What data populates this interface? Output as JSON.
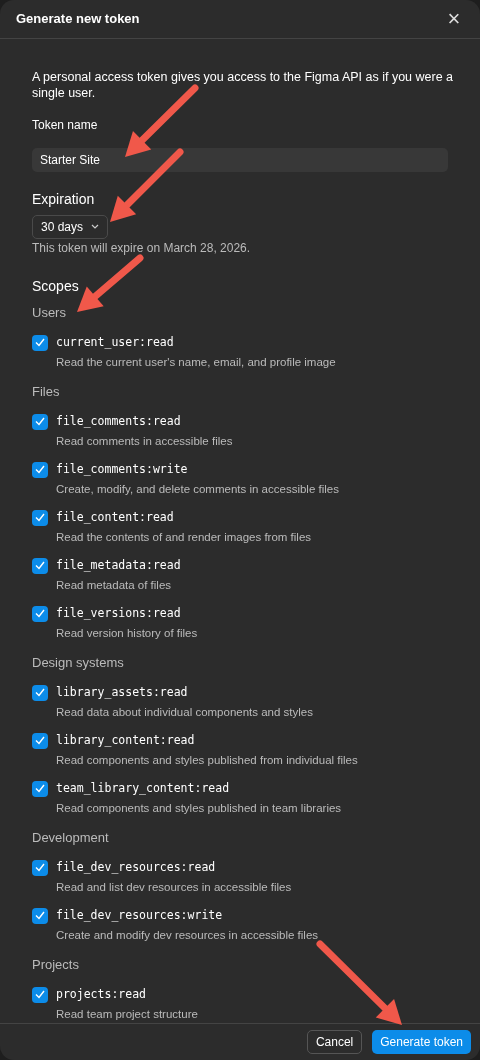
{
  "dialog": {
    "title": "Generate new token",
    "close": "×"
  },
  "description": "A personal access token gives you access to the Figma API as if you were a single user.",
  "token_name": {
    "label": "Token name",
    "value": "Starter Site"
  },
  "expiration": {
    "heading": "Expiration",
    "value": "30 days",
    "note": "This token will expire on March 28, 2026."
  },
  "scopes": {
    "heading": "Scopes",
    "groups": [
      {
        "name": "Users",
        "items": [
          {
            "name": "current_user:read",
            "description": "Read the current user's name, email, and profile image",
            "checked": true
          }
        ]
      },
      {
        "name": "Files",
        "items": [
          {
            "name": "file_comments:read",
            "description": "Read comments in accessible files",
            "checked": true
          },
          {
            "name": "file_comments:write",
            "description": "Create, modify, and delete comments in accessible files",
            "checked": true
          },
          {
            "name": "file_content:read",
            "description": "Read the contents of and render images from files",
            "checked": true
          },
          {
            "name": "file_metadata:read",
            "description": "Read metadata of files",
            "checked": true
          },
          {
            "name": "file_versions:read",
            "description": "Read version history of files",
            "checked": true
          }
        ]
      },
      {
        "name": "Design systems",
        "items": [
          {
            "name": "library_assets:read",
            "description": "Read data about individual components and styles",
            "checked": true
          },
          {
            "name": "library_content:read",
            "description": "Read components and styles published from individual files",
            "checked": true
          },
          {
            "name": "team_library_content:read",
            "description": "Read components and styles published in team libraries",
            "checked": true
          }
        ]
      },
      {
        "name": "Development",
        "items": [
          {
            "name": "file_dev_resources:read",
            "description": "Read and list dev resources in accessible files",
            "checked": true
          },
          {
            "name": "file_dev_resources:write",
            "description": "Create and modify dev resources in accessible files",
            "checked": true
          }
        ]
      },
      {
        "name": "Projects",
        "items": [
          {
            "name": "projects:read",
            "description": "Read team project structure",
            "checked": true
          }
        ]
      }
    ]
  },
  "buttons": {
    "cancel": "Cancel",
    "generate": "Generate token"
  }
}
